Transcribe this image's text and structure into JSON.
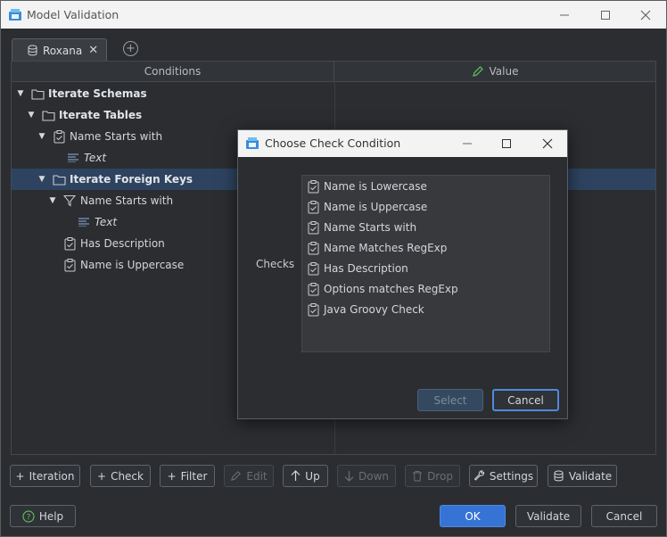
{
  "window": {
    "title": "Model Validation"
  },
  "tabs": [
    {
      "label": "Roxana"
    }
  ],
  "columns": {
    "conditions": "Conditions",
    "value": "Value"
  },
  "tree": [
    {
      "label": "Iterate Schemas",
      "style": "bold",
      "icon": "folder-icon"
    },
    {
      "label": "Iterate Tables",
      "style": "bold",
      "icon": "folder-icon"
    },
    {
      "label": "Name Starts with",
      "style": "plain",
      "icon": "clipboard-check-icon"
    },
    {
      "label": "Text",
      "style": "italic",
      "icon": "text-lines-icon"
    },
    {
      "label": "Iterate Foreign Keys",
      "style": "bold",
      "icon": "folder-icon",
      "selected": true
    },
    {
      "label": "Name Starts with",
      "style": "plain",
      "icon": "filter-icon"
    },
    {
      "label": "Text",
      "style": "italic",
      "icon": "text-lines-icon"
    },
    {
      "label": "Has Description",
      "style": "plain",
      "icon": "clipboard-check-icon"
    },
    {
      "label": "Name is Uppercase",
      "style": "plain",
      "icon": "clipboard-check-icon"
    }
  ],
  "toolbar": {
    "iteration": "Iteration",
    "check": "Check",
    "filter": "Filter",
    "edit": "Edit",
    "up": "Up",
    "down": "Down",
    "drop": "Drop",
    "settings": "Settings",
    "validate": "Validate"
  },
  "footer": {
    "help": "Help",
    "ok": "OK",
    "validate": "Validate",
    "cancel": "Cancel"
  },
  "dialog": {
    "title": "Choose Check Condition",
    "checks_label": "Checks",
    "items": [
      "Name is Lowercase",
      "Name is Uppercase",
      "Name Starts with",
      "Name Matches RegExp",
      "Has Description",
      "Options matches RegExp",
      "Java Groovy Check"
    ],
    "select": "Select",
    "cancel": "Cancel"
  },
  "colors": {
    "accent": "#3574d4",
    "selection": "#2e4360",
    "background": "#2b2d30"
  }
}
